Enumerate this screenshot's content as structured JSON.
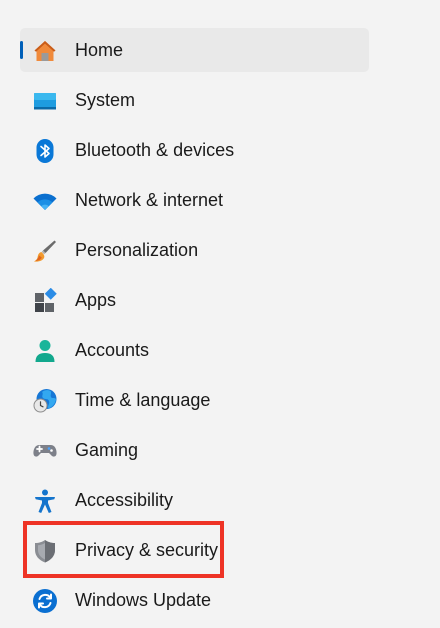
{
  "nav": {
    "items": [
      {
        "label": "Home",
        "icon": "home-icon",
        "selected": true
      },
      {
        "label": "System",
        "icon": "system-icon"
      },
      {
        "label": "Bluetooth & devices",
        "icon": "bluetooth-icon"
      },
      {
        "label": "Network & internet",
        "icon": "wifi-icon"
      },
      {
        "label": "Personalization",
        "icon": "brush-icon"
      },
      {
        "label": "Apps",
        "icon": "apps-icon"
      },
      {
        "label": "Accounts",
        "icon": "accounts-icon"
      },
      {
        "label": "Time & language",
        "icon": "globe-clock-icon"
      },
      {
        "label": "Gaming",
        "icon": "gamepad-icon"
      },
      {
        "label": "Accessibility",
        "icon": "accessibility-icon"
      },
      {
        "label": "Privacy & security",
        "icon": "shield-icon",
        "highlighted": true
      },
      {
        "label": "Windows Update",
        "icon": "update-icon"
      }
    ]
  },
  "colors": {
    "accent": "#005fb8",
    "highlight": "#ee3325",
    "selected_bg": "#e9e9e9"
  }
}
